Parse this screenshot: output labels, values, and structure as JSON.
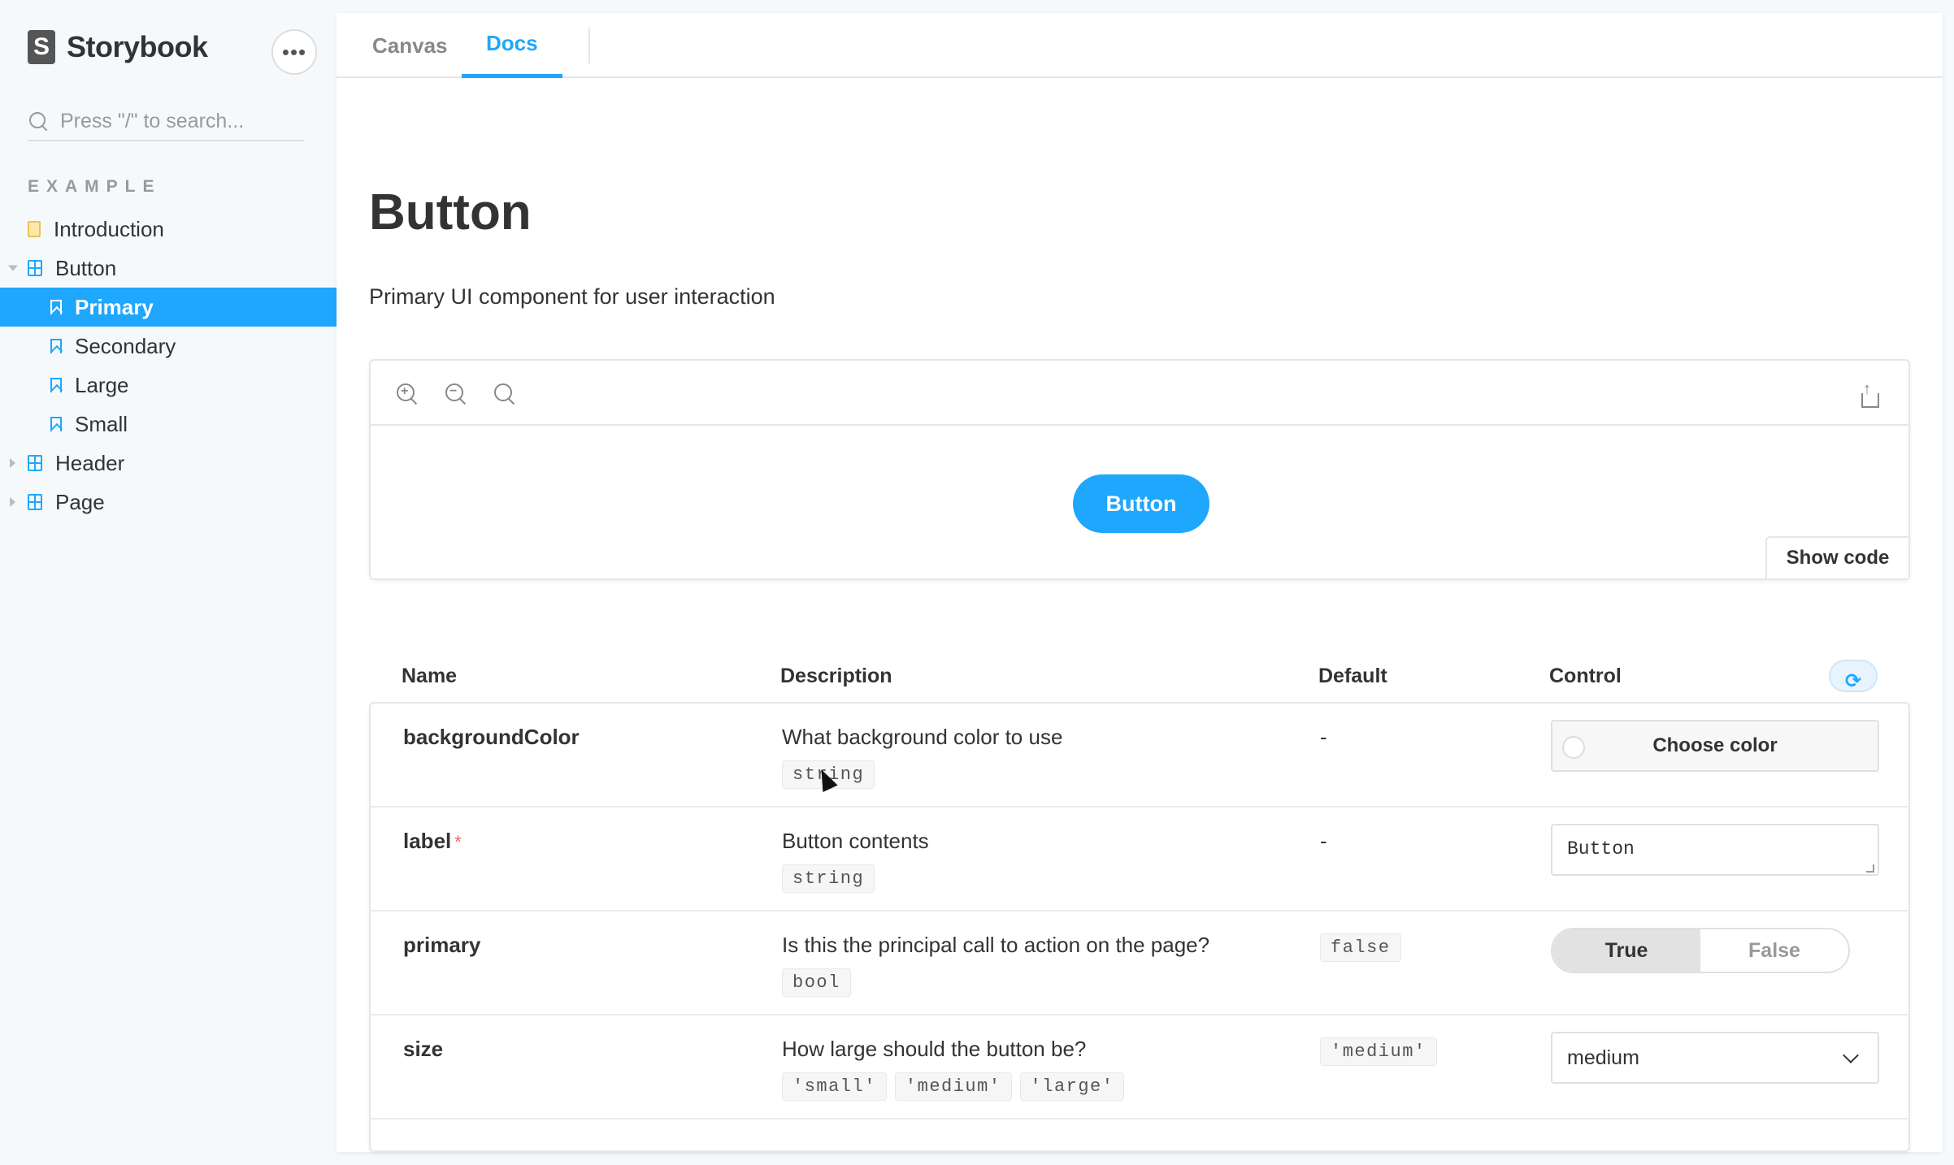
{
  "brand": {
    "name": "Storybook",
    "logo_letter": "S"
  },
  "sidebar": {
    "more_label": "•••",
    "search": {
      "placeholder": "Press \"/\" to search..."
    },
    "section": "EXAMPLE",
    "items": [
      {
        "label": "Introduction",
        "icon": "document-icon"
      },
      {
        "label": "Button",
        "icon": "component-icon",
        "expanded": true
      },
      {
        "label": "Primary",
        "icon": "bookmark-icon",
        "selected": true
      },
      {
        "label": "Secondary",
        "icon": "bookmark-icon"
      },
      {
        "label": "Large",
        "icon": "bookmark-icon"
      },
      {
        "label": "Small",
        "icon": "bookmark-icon"
      },
      {
        "label": "Header",
        "icon": "component-icon"
      },
      {
        "label": "Page",
        "icon": "component-icon"
      }
    ]
  },
  "tabs": [
    {
      "label": "Canvas",
      "active": false
    },
    {
      "label": "Docs",
      "active": true
    }
  ],
  "docs": {
    "title": "Button",
    "subtitle": "Primary UI component for user interaction",
    "preview": {
      "button_label": "Button",
      "show_code": "Show code"
    }
  },
  "args_table": {
    "headers": {
      "name": "Name",
      "description": "Description",
      "default": "Default",
      "control": "Control"
    },
    "rows": [
      {
        "name": "backgroundColor",
        "required": false,
        "description": "What background color to use",
        "types": [
          "string"
        ],
        "default": "-",
        "control": {
          "kind": "color",
          "label": "Choose color"
        }
      },
      {
        "name": "label",
        "required": true,
        "required_mark": "*",
        "description": "Button contents",
        "types": [
          "string"
        ],
        "default": "-",
        "control": {
          "kind": "text",
          "value": "Button"
        }
      },
      {
        "name": "primary",
        "required": false,
        "description": "Is this the principal call to action on the page?",
        "types": [
          "bool"
        ],
        "default": "false",
        "control": {
          "kind": "boolean",
          "true_label": "True",
          "false_label": "False",
          "value": true
        }
      },
      {
        "name": "size",
        "required": false,
        "description": "How large should the button be?",
        "types": [
          "'small'",
          "'medium'",
          "'large'"
        ],
        "default": "'medium'",
        "control": {
          "kind": "select",
          "value": "medium"
        }
      }
    ]
  },
  "colors": {
    "accent": "#1ea7fd",
    "sidebar_bg": "#f6f9fc"
  }
}
